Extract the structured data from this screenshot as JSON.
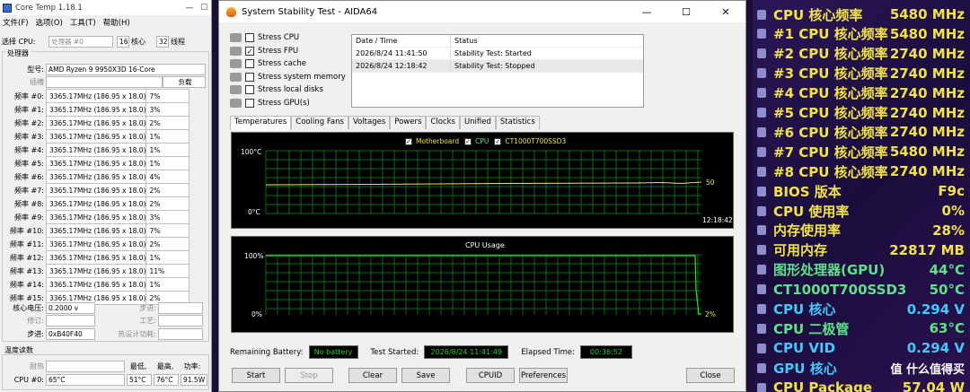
{
  "coretemp": {
    "title": "Core Temp 1.18.1",
    "menu": [
      "文件(F)",
      "选项(O)",
      "工具(T)",
      "帮助(H)"
    ],
    "select_label": "选择 CPU:",
    "processor_sel": "处理器 #0",
    "cores": "16",
    "cores_label": "核心",
    "threads": "32",
    "threads_label": "线程",
    "proc_group": "处理器",
    "model_label": "型号:",
    "model": "AMD Ryzen 9 9950X3D 16-Core",
    "socket_label": "插槽",
    "load_header": "负载",
    "freq_rows": [
      {
        "label": "频率 #0:",
        "freq": "3365.17MHz (186.95 x 18.0)",
        "load": "7%"
      },
      {
        "label": "频率 #1:",
        "freq": "3365.17MHz (186.95 x 18.0)",
        "load": "3%"
      },
      {
        "label": "频率 #2:",
        "freq": "3365.17MHz (186.95 x 18.0)",
        "load": "2%"
      },
      {
        "label": "频率 #3:",
        "freq": "3365.17MHz (186.95 x 18.0)",
        "load": "1%"
      },
      {
        "label": "频率 #4:",
        "freq": "3365.17MHz (186.95 x 18.0)",
        "load": "1%"
      },
      {
        "label": "频率 #5:",
        "freq": "3365.17MHz (186.95 x 18.0)",
        "load": "1%"
      },
      {
        "label": "频率 #6:",
        "freq": "3365.17MHz (186.95 x 18.0)",
        "load": "4%"
      },
      {
        "label": "频率 #7:",
        "freq": "3365.17MHz (186.95 x 18.0)",
        "load": "2%"
      },
      {
        "label": "频率 #8:",
        "freq": "3365.17MHz (186.95 x 18.0)",
        "load": "2%"
      },
      {
        "label": "频率 #9:",
        "freq": "3365.17MHz (186.95 x 18.0)",
        "load": "3%"
      },
      {
        "label": "频率 #10:",
        "freq": "3365.17MHz (186.95 x 18.0)",
        "load": "7%"
      },
      {
        "label": "频率 #11:",
        "freq": "3365.17MHz (186.95 x 18.0)",
        "load": "2%"
      },
      {
        "label": "频率 #12:",
        "freq": "3365.17MHz (186.95 x 18.0)",
        "load": "1%"
      },
      {
        "label": "频率 #13:",
        "freq": "3365.17MHz (186.95 x 18.0)",
        "load": "11%"
      },
      {
        "label": "频率 #14:",
        "freq": "3365.17MHz (186.95 x 18.0)",
        "load": "1%"
      },
      {
        "label": "频率 #15:",
        "freq": "3365.17MHz (186.95 x 18.0)",
        "load": "2%"
      }
    ],
    "vcore_label": "核心电压:",
    "vcore": "0.2000 v",
    "stepping_label": "步进:",
    "revision_label": "修订:",
    "tech_label": "工艺:",
    "cpuid_label": "步进:",
    "cpuid": "0xB40F40",
    "tdp_label": "热设计功耗:",
    "temp_group": "温度读数",
    "tj_label": "耐热",
    "min_label": "最低,",
    "max_label": "最高,",
    "power_label": "功率:",
    "cpu0_label": "CPU #0:",
    "cpu0_temp": "65°C",
    "cpu0_min": "51°C",
    "cpu0_max": "76°C",
    "cpu0_power": "91.5W"
  },
  "aida": {
    "title": "System Stability Test - AIDA64",
    "stress": [
      {
        "label": "Stress CPU",
        "checked": ""
      },
      {
        "label": "Stress FPU",
        "checked": "✓"
      },
      {
        "label": "Stress cache",
        "checked": ""
      },
      {
        "label": "Stress system memory",
        "checked": ""
      },
      {
        "label": "Stress local disks",
        "checked": ""
      },
      {
        "label": "Stress GPU(s)",
        "checked": ""
      }
    ],
    "log_headers": [
      "Date / Time",
      "Status"
    ],
    "log": [
      {
        "time": "2026/8/24 11:41:50",
        "status": "Stability Test: Started"
      },
      {
        "time": "2026/8/24 12:18:42",
        "status": "Stability Test: Stopped"
      }
    ],
    "tabs": [
      "Temperatures",
      "Cooling Fans",
      "Voltages",
      "Powers",
      "Clocks",
      "Unified",
      "Statistics"
    ],
    "temp_graph": {
      "legend": [
        "Motherboard",
        "CPU",
        "CT1000T700SSD3"
      ],
      "y_top": "100°C",
      "y_bottom": "0°C",
      "time": "12:18:42",
      "value": "50"
    },
    "usage_graph": {
      "title": "CPU Usage",
      "y_top": "100%",
      "y_bottom": "0%",
      "value": "2%"
    },
    "remaining_label": "Remaining Battery:",
    "remaining": "No battery",
    "started_label": "Test Started:",
    "started": "2026/8/24 11:41:49",
    "elapsed_label": "Elapsed Time:",
    "elapsed": "00:36:52",
    "buttons": [
      "Start",
      "Stop",
      "Clear",
      "Save",
      "CPUID",
      "Preferences",
      "Close"
    ]
  },
  "osd": [
    {
      "label": "CPU 核心频率",
      "value": "5480 MHz",
      "color": "#f2e24a"
    },
    {
      "label": "#1 CPU 核心频率",
      "value": "5480 MHz",
      "color": "#f2e24a"
    },
    {
      "label": "#2 CPU 核心频率",
      "value": "2740 MHz",
      "color": "#f2e24a"
    },
    {
      "label": "#3 CPU 核心频率",
      "value": "2740 MHz",
      "color": "#f2e24a"
    },
    {
      "label": "#4 CPU 核心频率",
      "value": "2740 MHz",
      "color": "#f2e24a"
    },
    {
      "label": "#5 CPU 核心频率",
      "value": "2740 MHz",
      "color": "#f2e24a"
    },
    {
      "label": "#6 CPU 核心频率",
      "value": "2740 MHz",
      "color": "#f2e24a"
    },
    {
      "label": "#7 CPU 核心频率",
      "value": "5480 MHz",
      "color": "#f2e24a"
    },
    {
      "label": "#8 CPU 核心频率",
      "value": "2740 MHz",
      "color": "#f2e24a"
    },
    {
      "label": "BIOS 版本",
      "value": "F9c",
      "color": "#f2e24a"
    },
    {
      "label": "CPU 使用率",
      "value": "0%",
      "color": "#f2e24a"
    },
    {
      "label": "内存使用率",
      "value": "28%",
      "color": "#f2e24a"
    },
    {
      "label": "可用内存",
      "value": "22817 MB",
      "color": "#f2e24a"
    },
    {
      "label": "图形处理器(GPU)",
      "value": "44°C",
      "color": "#5fe08a"
    },
    {
      "label": "CT1000T700SSD3",
      "value": "50°C",
      "color": "#5fe08a"
    },
    {
      "label": "CPU 核心",
      "value": "0.294 V",
      "color": "#42c8ff"
    },
    {
      "label": "CPU 二极管",
      "value": "63°C",
      "color": "#5fe08a"
    },
    {
      "label": "CPU VID",
      "value": "0.294 V",
      "color": "#42c8ff"
    },
    {
      "label": "GPU 核心",
      "value": "值 什么值得买",
      "color": "#42c8ff"
    },
    {
      "label": "CPU Package",
      "value": "57.04 W",
      "color": "#f2e24a"
    }
  ]
}
